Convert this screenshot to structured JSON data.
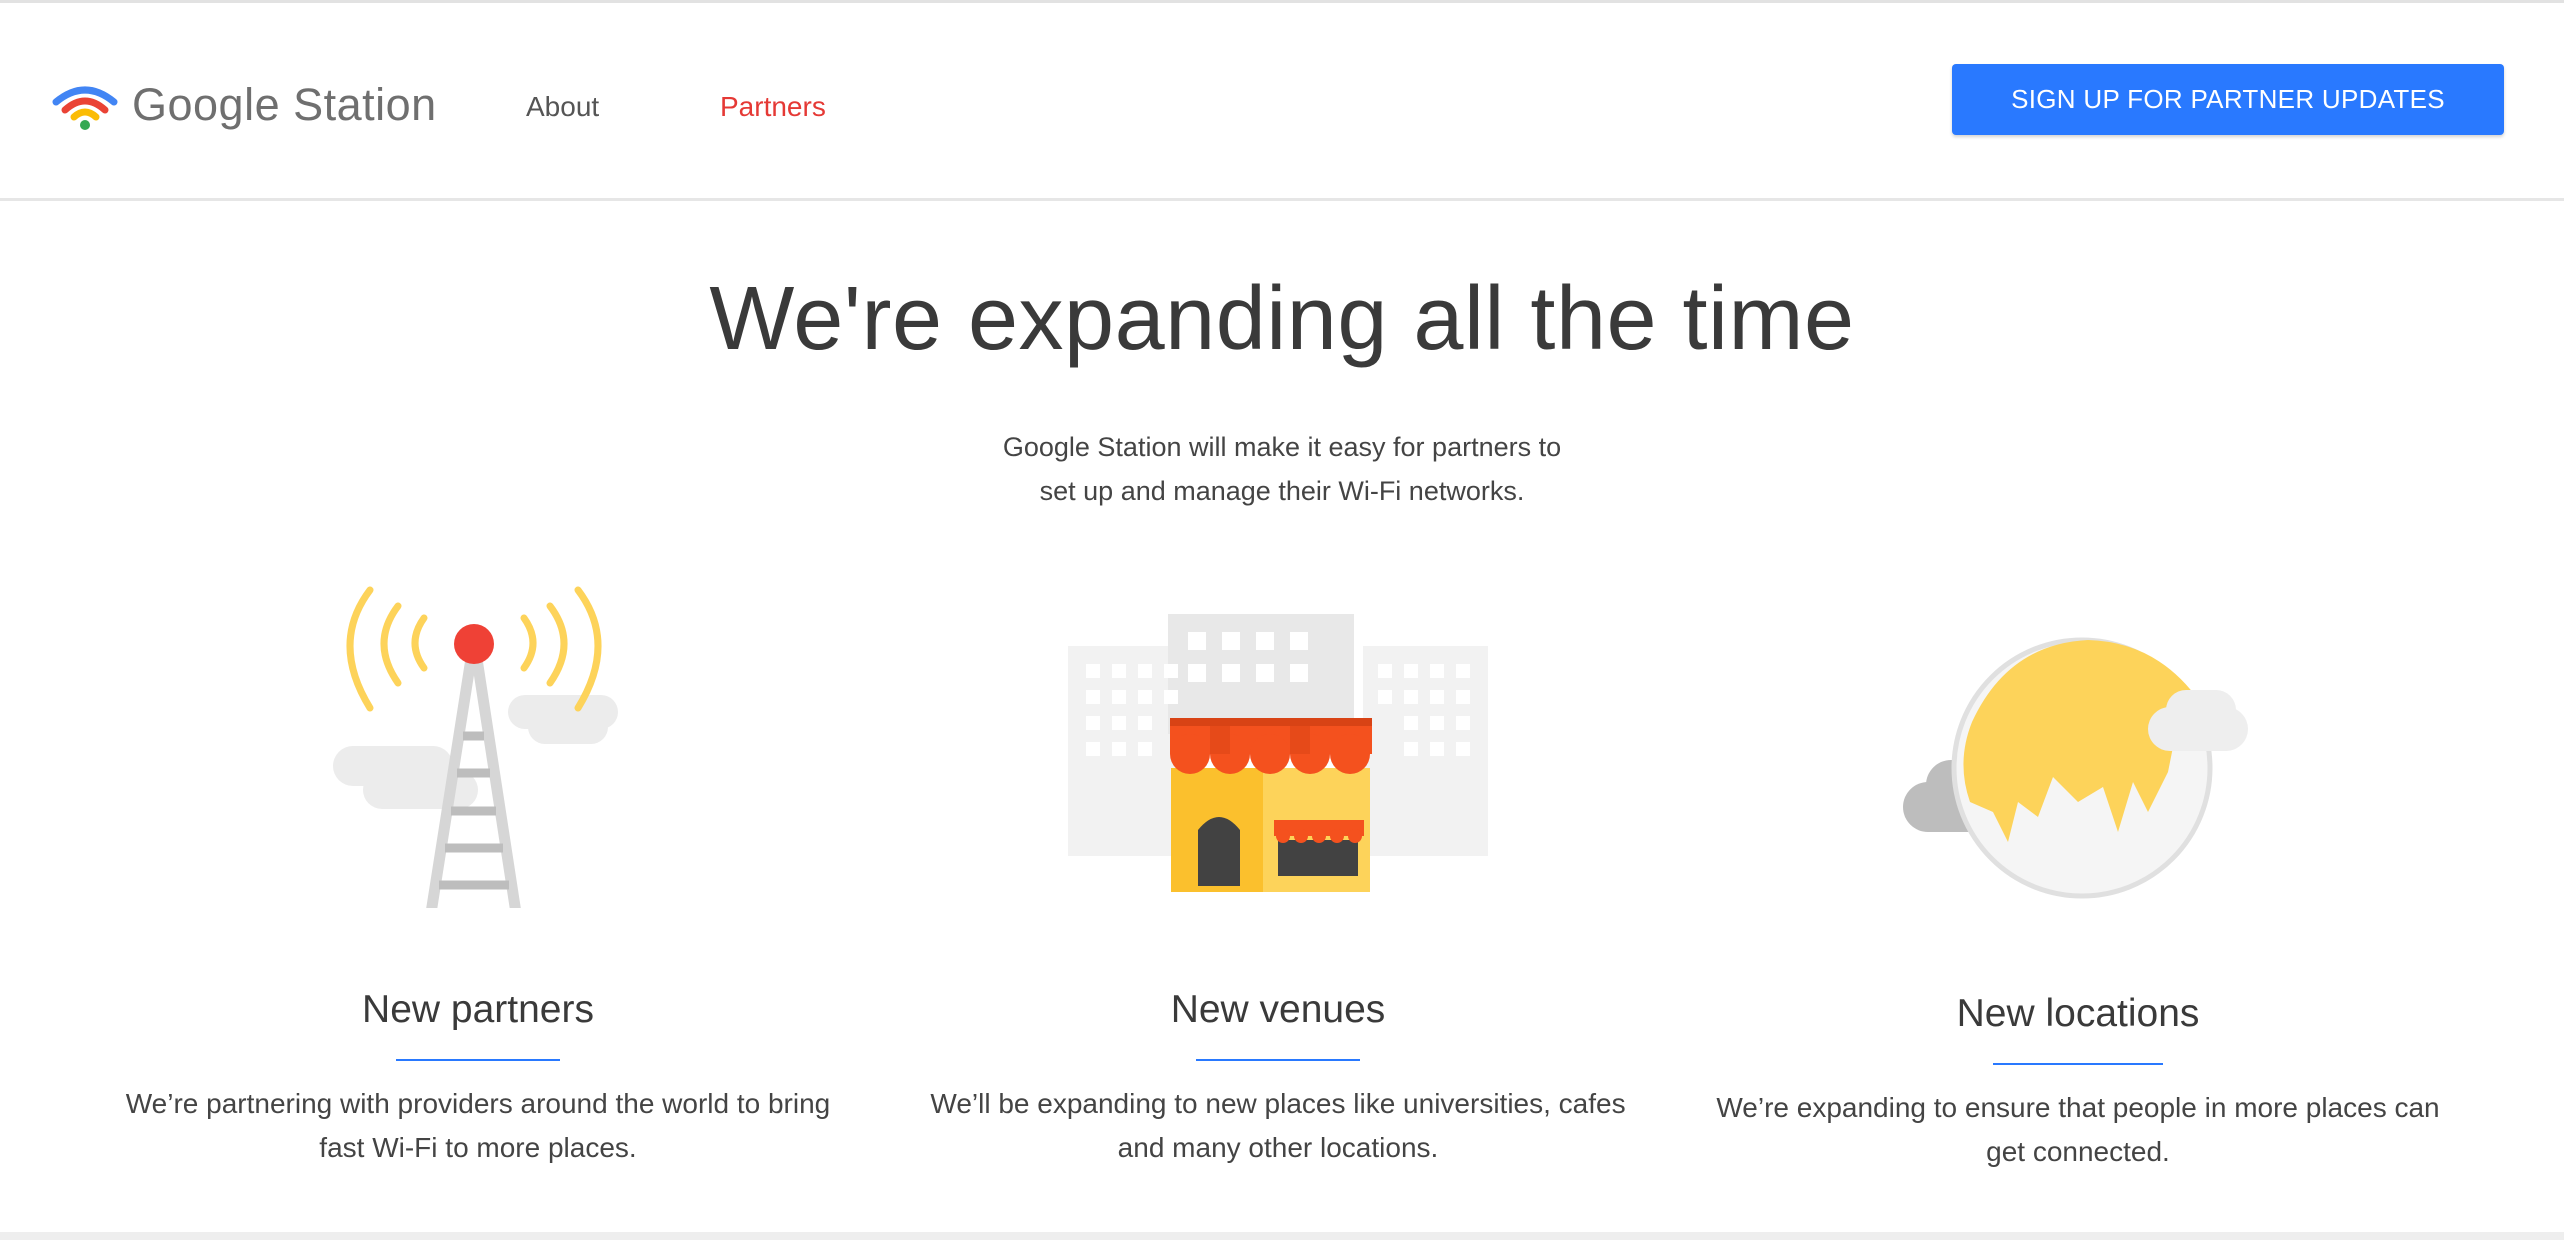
{
  "brand": {
    "logo_text": "Google Station",
    "logo_colors": [
      "#4285F4",
      "#EA4335",
      "#FBBC05",
      "#34A853"
    ]
  },
  "nav": {
    "items": [
      {
        "label": "About",
        "active": false
      },
      {
        "label": "Partners",
        "active": true
      }
    ],
    "cta_label": "SIGN UP FOR PARTNER UPDATES"
  },
  "hero": {
    "title": "We're expanding all the time",
    "subtitle_lines": [
      "Google Station will make it easy for partners to",
      "set up and manage their Wi-Fi networks."
    ]
  },
  "features": [
    {
      "icon": "radio-tower-icon",
      "title": "New partners",
      "description_lines": [
        "We’re partnering with providers around the world to bring",
        "fast Wi-Fi to more places."
      ]
    },
    {
      "icon": "storefront-icon",
      "title": "New venues",
      "description_lines": [
        "We’ll be expanding to new places like universities, cafes",
        "and many other locations."
      ]
    },
    {
      "icon": "globe-icon",
      "title": "New locations",
      "description_lines": [
        "We’re expanding to ensure that people in more places can",
        "get connected."
      ]
    }
  ],
  "colors": {
    "accent_blue": "#2979ff",
    "active_red": "#e53935",
    "illustration_yellow": "#fdd35a",
    "awning_red": "#f4511e"
  }
}
